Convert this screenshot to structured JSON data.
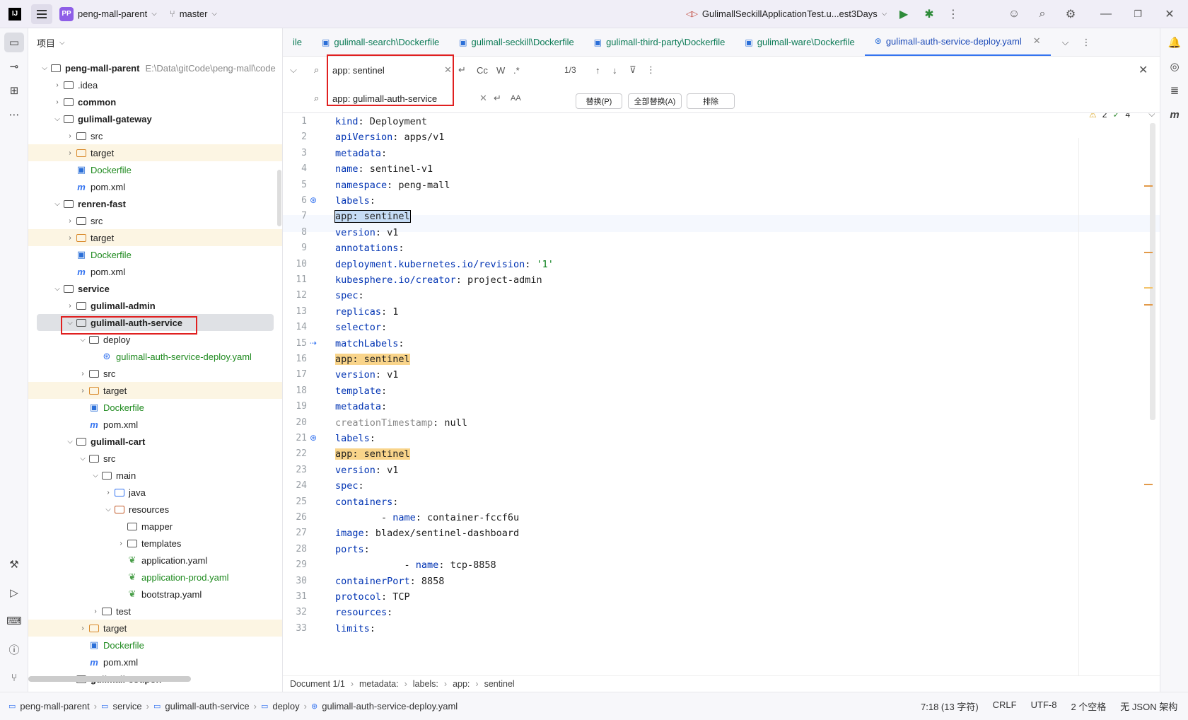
{
  "titlebar": {
    "logo": "IJ",
    "project_badge": "PP",
    "project_name": "peng-mall-parent",
    "branch": "master",
    "run_config": "GulimallSeckillApplicationTest.u...est3Days"
  },
  "project_panel": {
    "title": "项目",
    "items": [
      {
        "label": "peng-mall-parent",
        "extra": "E:\\Data\\gitCode\\peng-mall\\code",
        "bold": true
      },
      {
        "label": ".idea"
      },
      {
        "label": "common",
        "bold": true
      },
      {
        "label": "gulimall-gateway",
        "bold": true
      },
      {
        "label": "src"
      },
      {
        "label": "target"
      },
      {
        "label": "Dockerfile"
      },
      {
        "label": "pom.xml"
      },
      {
        "label": "renren-fast",
        "bold": true
      },
      {
        "label": "src"
      },
      {
        "label": "target"
      },
      {
        "label": "Dockerfile"
      },
      {
        "label": "pom.xml"
      },
      {
        "label": "service",
        "bold": true
      },
      {
        "label": "gulimall-admin",
        "bold": true
      },
      {
        "label": "gulimall-auth-service",
        "bold": true
      },
      {
        "label": "deploy"
      },
      {
        "label": "gulimall-auth-service-deploy.yaml"
      },
      {
        "label": "src"
      },
      {
        "label": "target"
      },
      {
        "label": "Dockerfile"
      },
      {
        "label": "pom.xml"
      },
      {
        "label": "gulimall-cart",
        "bold": true
      },
      {
        "label": "src"
      },
      {
        "label": "main"
      },
      {
        "label": "java"
      },
      {
        "label": "resources"
      },
      {
        "label": "mapper"
      },
      {
        "label": "templates"
      },
      {
        "label": "application.yaml"
      },
      {
        "label": "application-prod.yaml"
      },
      {
        "label": "bootstrap.yaml"
      },
      {
        "label": "test"
      },
      {
        "label": "target"
      },
      {
        "label": "Dockerfile"
      },
      {
        "label": "pom.xml"
      },
      {
        "label": "gulimall-coupon",
        "bold": true
      }
    ]
  },
  "tabs": [
    {
      "label": "ile"
    },
    {
      "label": "gulimall-search\\Dockerfile"
    },
    {
      "label": "gulimall-seckill\\Dockerfile"
    },
    {
      "label": "gulimall-third-party\\Dockerfile"
    },
    {
      "label": "gulimall-ware\\Dockerfile"
    },
    {
      "label": "gulimall-auth-service-deploy.yaml"
    }
  ],
  "find": {
    "search_value": "app: sentinel",
    "replace_value": "app: gulimall-auth-service",
    "match_count": "1/3",
    "opt_case": "Cc",
    "opt_word": "W",
    "opt_regex": ".*",
    "replace_btn": "替换(P)",
    "replace_all_btn": "全部替换(A)",
    "exclude_btn": "排除"
  },
  "editor": {
    "warnings": "2",
    "checks": "4",
    "lines": [
      "kind: Deployment",
      "apiVersion: apps/v1",
      "metadata:",
      "  name: sentinel-v1",
      "  namespace: peng-mall",
      "  labels:",
      "    app: sentinel",
      "    version: v1",
      "  annotations:",
      "    deployment.kubernetes.io/revision: '1'",
      "    kubesphere.io/creator: project-admin",
      "spec:",
      "  replicas: 1",
      "  selector:",
      "    matchLabels:",
      "      app: sentinel",
      "      version: v1",
      "  template:",
      "    metadata:",
      "      creationTimestamp: null",
      "      labels:",
      "        app: sentinel",
      "        version: v1",
      "    spec:",
      "      containers:",
      "        - name: container-fccf6u",
      "          image: bladex/sentinel-dashboard",
      "          ports:",
      "            - name: tcp-8858",
      "              containerPort: 8858",
      "              protocol: TCP",
      "          resources:",
      "            limits:"
    ]
  },
  "editor_crumbs": [
    "Document 1/1",
    "metadata:",
    "labels:",
    "app:",
    "sentinel"
  ],
  "status": {
    "path": [
      "peng-mall-parent",
      "service",
      "gulimall-auth-service",
      "deploy",
      "gulimall-auth-service-deploy.yaml"
    ],
    "position": "7:18 (13 字符)",
    "line_sep": "CRLF",
    "encoding": "UTF-8",
    "indent": "2 个空格",
    "schema": "无 JSON 架构"
  }
}
